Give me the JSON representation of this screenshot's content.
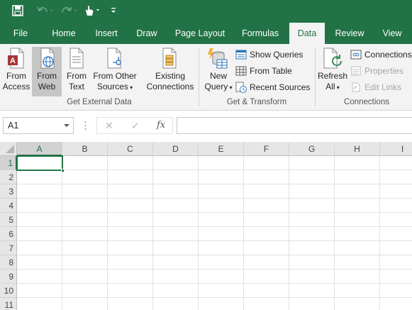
{
  "qat": {
    "icons": [
      "save-icon",
      "undo-icon",
      "redo-icon",
      "touch-mode-icon",
      "customize-qat-icon"
    ]
  },
  "tabs": [
    {
      "label": "File"
    },
    {
      "label": "Home"
    },
    {
      "label": "Insert"
    },
    {
      "label": "Draw"
    },
    {
      "label": "Page Layout"
    },
    {
      "label": "Formulas"
    },
    {
      "label": "Data",
      "active": true
    },
    {
      "label": "Review"
    },
    {
      "label": "View"
    }
  ],
  "ribbon": {
    "get_external": {
      "from_access": [
        "From",
        "Access"
      ],
      "from_web": [
        "From",
        "Web"
      ],
      "from_text": [
        "From",
        "Text"
      ],
      "from_other": [
        "From Other",
        "Sources"
      ],
      "existing": [
        "Existing",
        "Connections"
      ],
      "label": "Get External Data"
    },
    "get_transform": {
      "new_query": [
        "New",
        "Query"
      ],
      "show_queries": "Show Queries",
      "from_table": "From Table",
      "recent_sources": "Recent Sources",
      "label": "Get & Transform"
    },
    "connections": {
      "refresh": [
        "Refresh",
        "All"
      ],
      "connections": "Connections",
      "properties": "Properties",
      "edit_links": "Edit Links",
      "label": "Connections"
    }
  },
  "formula_bar": {
    "name_box": "A1",
    "cancel": "✕",
    "enter": "✓",
    "fx": "fx",
    "formula": ""
  },
  "grid": {
    "columns": [
      "A",
      "B",
      "C",
      "D",
      "E",
      "F",
      "G",
      "H",
      "I"
    ],
    "rows": [
      "1",
      "2",
      "3",
      "4",
      "5",
      "6",
      "7",
      "8",
      "9",
      "10",
      "11"
    ],
    "selected_cell": "A1"
  },
  "colors": {
    "accent": "#217346",
    "ribbon_bg": "#f3f3f3"
  }
}
